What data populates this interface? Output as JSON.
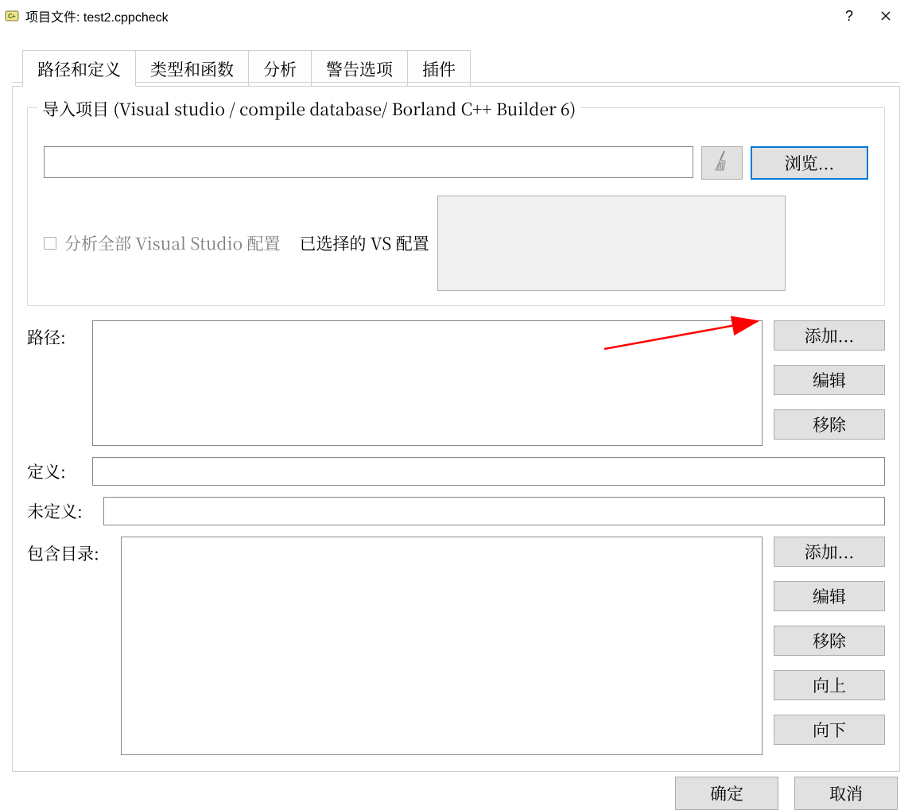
{
  "window": {
    "title": "项目文件: test2.cppcheck"
  },
  "tabs": {
    "t1": "路径和定义",
    "t2": "类型和函数",
    "t3": "分析",
    "t4": "警告选项",
    "t5": "插件"
  },
  "group": {
    "title": "导入项目 (Visual studio / compile database/ Borland C++ Builder 6)",
    "browse": "浏览...",
    "analyze_all_label": "分析全部 Visual Studio 配置",
    "selected_vs_label": "已选择的 VS 配置"
  },
  "labels": {
    "paths": "路径:",
    "defines": "定义:",
    "undefines": "未定义:",
    "includes": "包含目录:"
  },
  "buttons": {
    "add": "添加...",
    "edit": "编辑",
    "remove": "移除",
    "up": "向上",
    "down": "向下",
    "ok": "确定",
    "cancel": "取消"
  }
}
